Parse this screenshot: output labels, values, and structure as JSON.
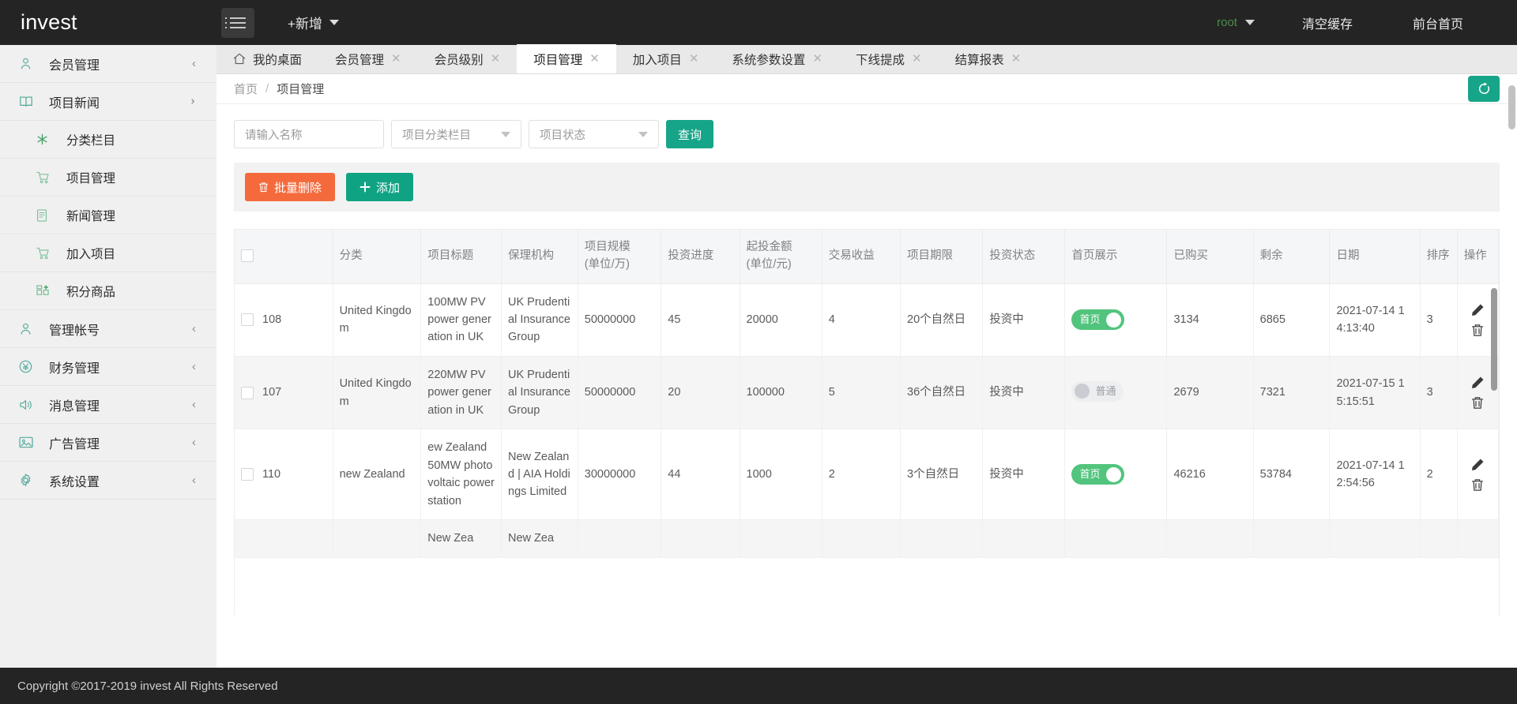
{
  "header": {
    "brand": "invest",
    "menu_icon": "hamburger-icon",
    "add_new": "+新增",
    "user": "root",
    "clear_cache": "清空缓存",
    "front_home": "前台首页"
  },
  "sidebar": {
    "items": [
      {
        "label": "会员管理",
        "icon": "user-icon",
        "arrow": "‹",
        "sub": false
      },
      {
        "label": "项目新闻",
        "icon": "book-icon",
        "arrow": "⌄",
        "sub": false,
        "open": true
      },
      {
        "label": "分类栏目",
        "icon": "asterisk-icon",
        "arrow": "",
        "sub": true
      },
      {
        "label": "项目管理",
        "icon": "cart-icon",
        "arrow": "",
        "sub": true,
        "active": true
      },
      {
        "label": "新闻管理",
        "icon": "document-icon",
        "arrow": "",
        "sub": true
      },
      {
        "label": "加入项目",
        "icon": "cart-icon",
        "arrow": "",
        "sub": true
      },
      {
        "label": "积分商品",
        "icon": "grid-icon",
        "arrow": "",
        "sub": true
      },
      {
        "label": "管理帐号",
        "icon": "person-icon",
        "arrow": "‹",
        "sub": false
      },
      {
        "label": "财务管理",
        "icon": "yen-icon",
        "arrow": "‹",
        "sub": false
      },
      {
        "label": "消息管理",
        "icon": "speaker-icon",
        "arrow": "‹",
        "sub": false
      },
      {
        "label": "广告管理",
        "icon": "image-icon",
        "arrow": "‹",
        "sub": false
      },
      {
        "label": "系统设置",
        "icon": "gear-icon",
        "arrow": "‹",
        "sub": false
      }
    ]
  },
  "tabs": [
    {
      "label": "我的桌面",
      "closable": false,
      "active": false,
      "icon": "home-icon"
    },
    {
      "label": "会员管理",
      "closable": true,
      "active": false
    },
    {
      "label": "会员级别",
      "closable": true,
      "active": false
    },
    {
      "label": "项目管理",
      "closable": true,
      "active": true
    },
    {
      "label": "加入项目",
      "closable": true,
      "active": false
    },
    {
      "label": "系统参数设置",
      "closable": true,
      "active": false
    },
    {
      "label": "下线提成",
      "closable": true,
      "active": false
    },
    {
      "label": "结算报表",
      "closable": true,
      "active": false
    }
  ],
  "breadcrumb": {
    "home": "首页",
    "sep": "/",
    "current": "项目管理"
  },
  "refresh_icon": "refresh-icon",
  "filters": {
    "name_placeholder": "请输入名称",
    "category_placeholder": "项目分类栏目",
    "status_placeholder": "项目状态",
    "query_label": "查询"
  },
  "toolbar": {
    "batch_delete": "批量删除",
    "add": "添加",
    "trash_icon": "trash-icon",
    "plus_icon": "plus-icon"
  },
  "table": {
    "columns": [
      "",
      "分类",
      "项目标题",
      "保理机构",
      "项目规模\n(单位/万)",
      "投资进度",
      "起投金额\n(单位/元)",
      "交易收益",
      "项目期限",
      "投资状态",
      "首页展示",
      "已购买",
      "剩余",
      "日期",
      "排序",
      "操作"
    ],
    "columns_line1": [
      "",
      "分类",
      "项目标题",
      "保理机构",
      "项目规模",
      "投资进度",
      "起投金额",
      "交易收益",
      "项目期限",
      "投资状态",
      "首页展示",
      "已购买",
      "剩余",
      "日期",
      "排序",
      "操作"
    ],
    "columns_line2": [
      "",
      "",
      "",
      "",
      "(单位/万)",
      "",
      "(单位/元)",
      "",
      "",
      "",
      "",
      "",
      "",
      "",
      "",
      ""
    ],
    "rows": [
      {
        "id": "108",
        "category": "United Kingdom",
        "title": "100MW PV power generation in UK",
        "agency": "UK Prudential Insurance Group",
        "scale": "50000000",
        "progress": "45",
        "min_amount": "20000",
        "yield": "4",
        "term": "20个自然日",
        "status": "投资中",
        "home_display": {
          "state": "on",
          "label": "首页"
        },
        "purchased": "3134",
        "remaining": "6865",
        "date": "2021-07-14 14:13:40",
        "sort": "3",
        "alt": false
      },
      {
        "id": "107",
        "category": "United Kingdom",
        "title": "220MW PV power generation in UK",
        "agency": "UK Prudential Insurance Group",
        "scale": "50000000",
        "progress": "20",
        "min_amount": "100000",
        "yield": "5",
        "term": "36个自然日",
        "status": "投资中",
        "home_display": {
          "state": "off",
          "label": "普通"
        },
        "purchased": "2679",
        "remaining": "7321",
        "date": "2021-07-15 15:15:51",
        "sort": "3",
        "alt": true
      },
      {
        "id": "110",
        "category": "new Zealand",
        "title": "ew Zealand 50MW photovoltaic power station",
        "agency": "New Zealand | AIA Holdings Limited",
        "scale": "30000000",
        "progress": "44",
        "min_amount": "1000",
        "yield": "2",
        "term": "3个自然日",
        "status": "投资中",
        "home_display": {
          "state": "on",
          "label": "首页"
        },
        "purchased": "46216",
        "remaining": "53784",
        "date": "2021-07-14 12:54:56",
        "sort": "2",
        "alt": false
      },
      {
        "id": "",
        "category": "",
        "title": "New Zea",
        "agency": "New Zea",
        "scale": "",
        "progress": "",
        "min_amount": "",
        "yield": "",
        "term": "",
        "status": "",
        "home_display": {
          "state": "none",
          "label": ""
        },
        "purchased": "",
        "remaining": "",
        "date": "",
        "sort": "",
        "alt": true
      }
    ],
    "edit_icon": "pencil-icon",
    "delete_icon": "trash-icon"
  },
  "footer": {
    "copyright": "Copyright ©2017-2019 invest All Rights Reserved"
  }
}
